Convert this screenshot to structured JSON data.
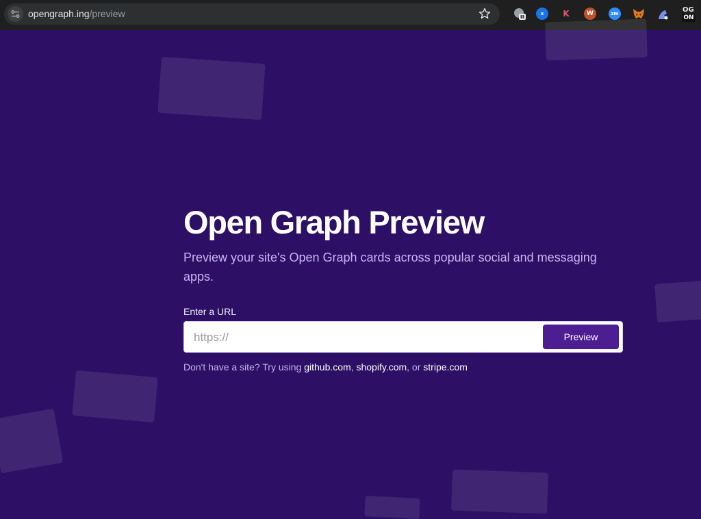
{
  "browser": {
    "url_host": "opengraph.ing",
    "url_path": "/preview",
    "extensions": [
      "shield-extension-icon",
      "x-extension-icon",
      "k-extension-icon",
      "wordpress-extension-icon",
      "zoom-extension-icon",
      "metamask-extension-icon",
      "figure-extension-icon",
      "og-extension-icon"
    ],
    "ext_labels": {
      "x": "x",
      "k": "K",
      "w": "W",
      "zm": "zm",
      "og_top": "OG",
      "og_bottom": "ON"
    }
  },
  "hero": {
    "title": "Open Graph Preview",
    "subtitle": "Preview your site's Open Graph cards across popular social and messaging apps."
  },
  "form": {
    "label": "Enter a URL",
    "placeholder": "https://",
    "button_label": "Preview"
  },
  "hint": {
    "prefix": "Don't have a site? Try using ",
    "link1": "github.com",
    "sep1": ", ",
    "link2": "shopify.com",
    "sep2": ", or ",
    "link3": "stripe.com"
  },
  "colors": {
    "background": "#2d1065",
    "button": "#4d1d92",
    "subtitle": "#c9b5f2"
  }
}
